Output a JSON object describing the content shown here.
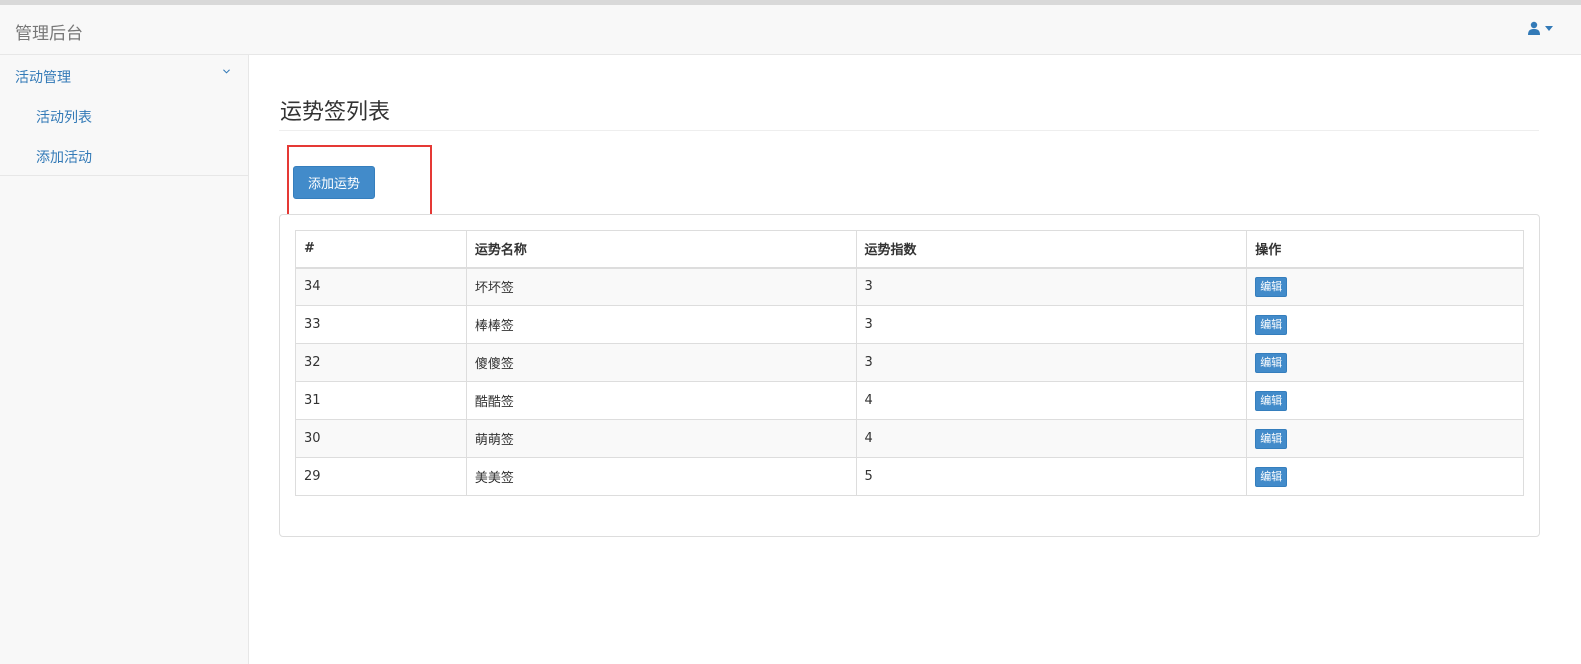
{
  "navbar": {
    "brand": "管理后台",
    "user_icon": "user-icon"
  },
  "sidebar": {
    "group": {
      "label": "活动管理",
      "icon": "chevron-down-icon"
    },
    "items": [
      {
        "label": "活动列表"
      },
      {
        "label": "添加活动"
      }
    ]
  },
  "main": {
    "title": "运势签列表",
    "add_button": "添加运势",
    "table": {
      "headers": [
        "#",
        "运势名称",
        "运势指数",
        "操作"
      ],
      "rows": [
        {
          "id": "34",
          "name": "坏坏签",
          "index": "3",
          "action": "编辑"
        },
        {
          "id": "33",
          "name": "棒棒签",
          "index": "3",
          "action": "编辑"
        },
        {
          "id": "32",
          "name": "傻傻签",
          "index": "3",
          "action": "编辑"
        },
        {
          "id": "31",
          "name": "酷酷签",
          "index": "4",
          "action": "编辑"
        },
        {
          "id": "30",
          "name": "萌萌签",
          "index": "4",
          "action": "编辑"
        },
        {
          "id": "29",
          "name": "美美签",
          "index": "5",
          "action": "编辑"
        }
      ]
    }
  },
  "colors": {
    "accent": "#337ab7",
    "button": "#428bca",
    "highlight": "#e53935"
  }
}
